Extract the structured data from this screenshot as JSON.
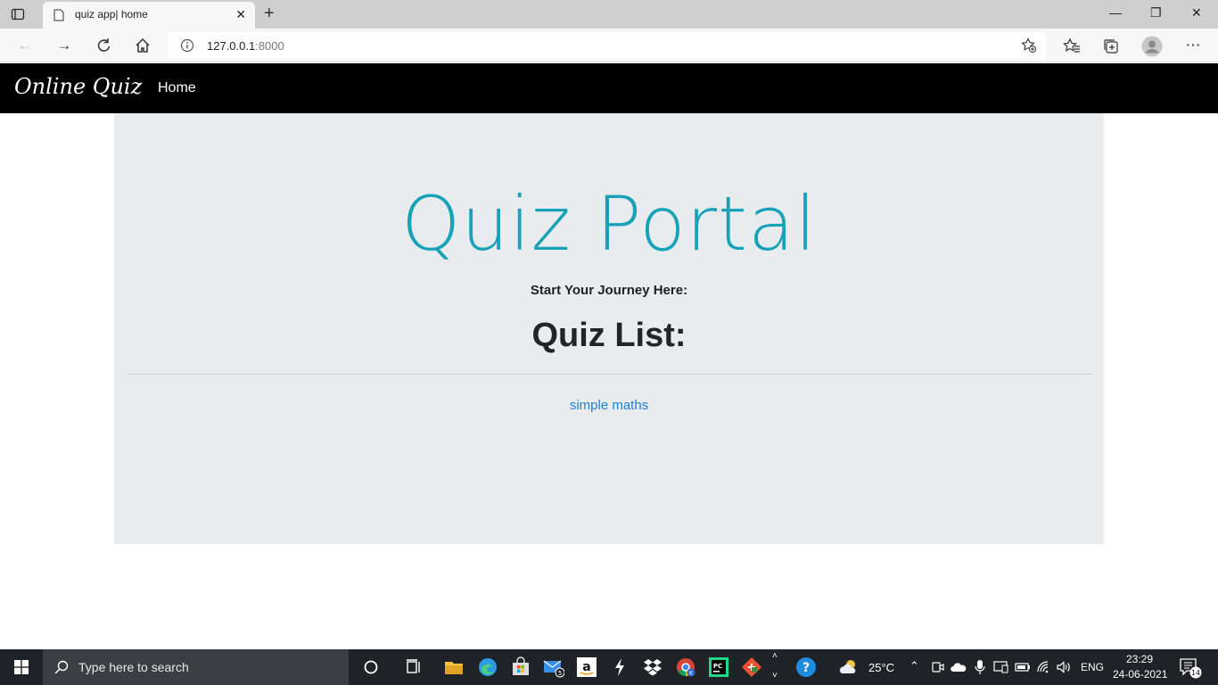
{
  "browser": {
    "tab_title": "quiz app| home",
    "tab_close": "✕",
    "new_tab": "+",
    "url_host": "127.0.0.1",
    "url_port": ":8000",
    "window": {
      "minimize": "—",
      "restore": "❐",
      "close": "✕"
    }
  },
  "site": {
    "brand": "Online Quiz",
    "nav": {
      "home": "Home"
    }
  },
  "jumbotron": {
    "title": "Quiz Portal",
    "lead": "Start Your Journey Here:",
    "list_heading": "Quiz List:",
    "quizzes": [
      "simple maths"
    ]
  },
  "taskbar": {
    "search_placeholder": "Type here to search",
    "weather": "25°C",
    "language": "ENG",
    "time": "23:29",
    "date": "24-06-2021",
    "mail_badge": "5",
    "notification_count": "14"
  },
  "colors": {
    "title_color": "#17a2b8",
    "link_color": "#1f7fd6",
    "navbar_bg": "#000000",
    "jumbotron_bg": "#e9ecef"
  }
}
